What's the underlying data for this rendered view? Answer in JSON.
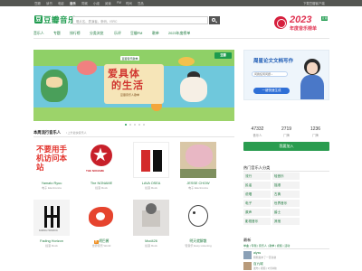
{
  "topnav": {
    "items": [
      "豆瓣",
      "读书",
      "电影",
      "音乐",
      "同城",
      "小组",
      "阅读",
      "FM",
      "时间",
      "豆品"
    ],
    "active_index": 3,
    "right_link": "下载豆瓣客户端"
  },
  "header": {
    "logo_glyph": "豆",
    "logo_text": "豆瓣音乐",
    "search_placeholder": "唱片名、表演者、条码、ISRC",
    "promo": {
      "year": "2023",
      "badge": "豆瓣",
      "subtitle": "年度音乐榜单"
    }
  },
  "subnav": [
    "音乐人",
    "专题",
    "排行榜",
    "分类浏览",
    "乐评",
    "豆瓣FM",
    "歌单",
    "2023年度榜单"
  ],
  "banner": {
    "title_line1": "爱具体",
    "title_line2": "的生活",
    "top_caption": "豆瓣音乐歌单",
    "bottom_caption": "豆瓣音乐人歌单",
    "tag": "豆瓣"
  },
  "carousel": {
    "count": 5,
    "active": 0
  },
  "weekly": {
    "title": "本周流行音乐人",
    "subtitle": "/ 上升最快音乐人",
    "artists": [
      {
        "name": "Yamato Ryuu",
        "genre": "电子 Electronica",
        "cover_text": "不要用手机访问本站"
      },
      {
        "name": "The NONAME",
        "genre": "摇滚 Rock",
        "cover_text": "THE NONAME"
      },
      {
        "name": "LAVA OSEA",
        "genre": "摇滚 Rock",
        "cover_text": ""
      },
      {
        "name": "JESSE CHOW",
        "genre": "电子 Electronica",
        "cover_text": ""
      },
      {
        "name": "Fading Horizon",
        "genre": "摇滚 Rock",
        "cover_text": "FADING HORIZON"
      },
      {
        "name": "胡巴酱",
        "genre": "世界音乐 World",
        "hot": "热"
      },
      {
        "name": "Mod426",
        "genre": "摇滚 Rock",
        "cover_text": ""
      },
      {
        "name": "明天就解散",
        "genre": "轻音乐 Easy Listening",
        "cover_text": ""
      }
    ]
  },
  "ad": {
    "header": "周星论文文档写作",
    "pill": "问我任何问题 ›",
    "button": "一键快速生成"
  },
  "stats": [
    {
      "num": "47332",
      "label": "音乐人"
    },
    {
      "num": "2719",
      "label": "厂牌"
    },
    {
      "num": "1236",
      "label": "厂牌"
    }
  ],
  "join_button": "我要加入",
  "hot_genres": {
    "title": "热门音乐人分类",
    "tags": [
      "流行",
      "轻音乐",
      "民谣",
      "摇滚",
      "说唱",
      "古典",
      "电子",
      "世界音乐",
      "原声",
      "爵士",
      "影视音乐",
      "其他"
    ]
  },
  "recent": {
    "title": "最新",
    "tabs": "单曲 | 专辑 | 音乐人 | 歌单 | 视频 | 活动",
    "users": [
      {
        "name": "alyss",
        "desc": "刚刚发布了一首新歌"
      },
      {
        "name": "百九城",
        "desc": "发布 | 视频 | 9分钟前"
      }
    ]
  }
}
